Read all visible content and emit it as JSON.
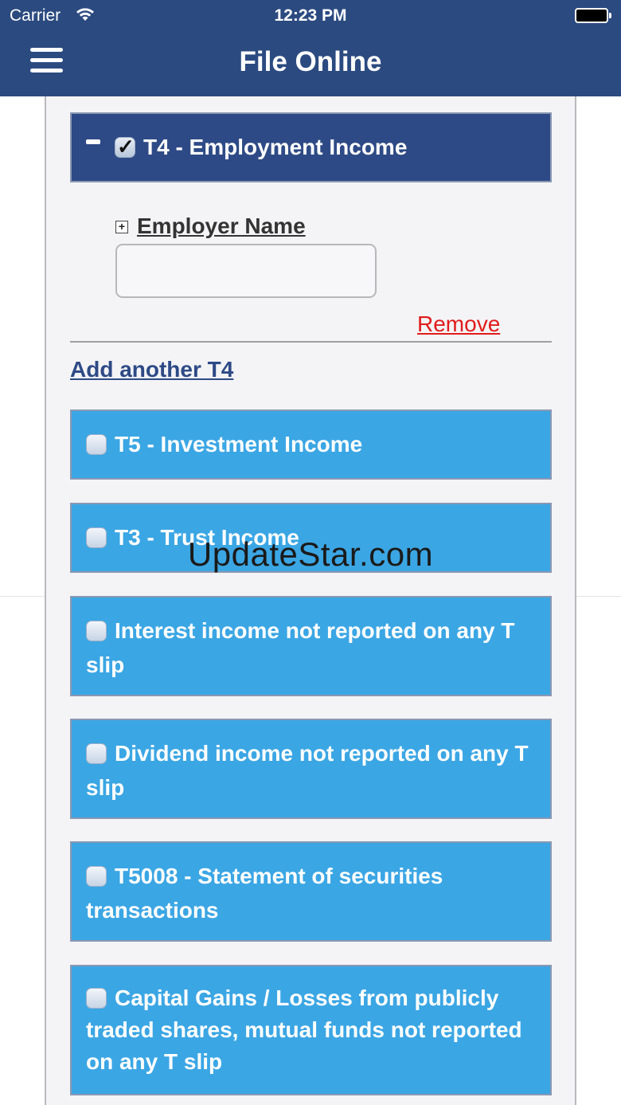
{
  "status_bar": {
    "carrier": "Carrier",
    "time": "12:23 PM"
  },
  "nav": {
    "title": "File Online"
  },
  "t4_section": {
    "title": "T4 - Employment Income",
    "checked": true,
    "expanded": true,
    "employer_label": "Employer Name",
    "employer_value": "",
    "remove_label": "Remove",
    "add_another_label": "Add another T4"
  },
  "sections": [
    {
      "title": "T5 - Investment Income",
      "checked": false
    },
    {
      "title": "T3 - Trust Income",
      "checked": false
    },
    {
      "title": "Interest income not reported on any T slip",
      "checked": false
    },
    {
      "title": "Dividend income not reported on any T slip",
      "checked": false
    },
    {
      "title": "T5008 - Statement of securities transactions",
      "checked": false
    },
    {
      "title": "Capital Gains / Losses from publicly traded shares, mutual funds not reported on any T slip",
      "checked": false
    }
  ],
  "watermark": "UpdateStar.com",
  "colors": {
    "header_bg": "#2b4a80",
    "section_dark": "#2e4a86",
    "section_light": "#3ba6e4",
    "remove_link": "#e01c1c",
    "add_link": "#2e4a86"
  },
  "icons": [
    "wifi-icon",
    "battery-icon",
    "menu-icon",
    "collapse-icon",
    "expand-icon",
    "checkbox-icon"
  ]
}
